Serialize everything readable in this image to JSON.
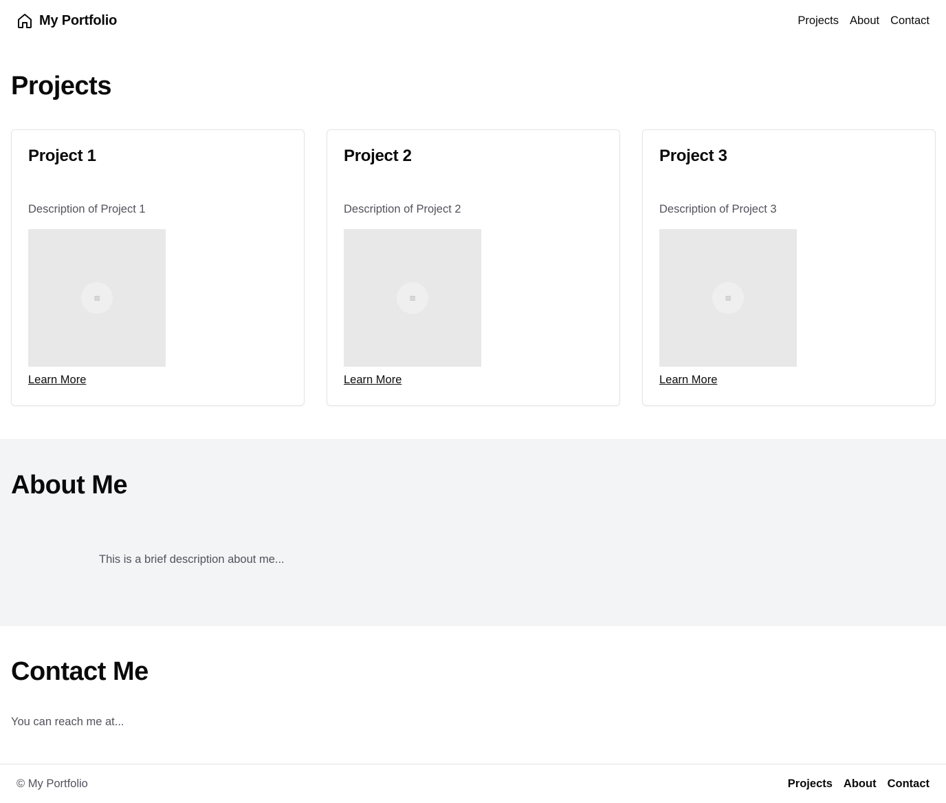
{
  "header": {
    "brand_icon": "home-icon",
    "brand_name": "My Portfolio",
    "nav": [
      "Projects",
      "About",
      "Contact"
    ]
  },
  "projects": {
    "title": "Projects",
    "items": [
      {
        "title": "Project 1",
        "description": "Description of Project 1",
        "image_icon": "image-placeholder-icon",
        "link": "Learn More"
      },
      {
        "title": "Project 2",
        "description": "Description of Project 2",
        "image_icon": "image-placeholder-icon",
        "link": "Learn More"
      },
      {
        "title": "Project 3",
        "description": "Description of Project 3",
        "image_icon": "image-placeholder-icon",
        "link": "Learn More"
      }
    ]
  },
  "about": {
    "title": "About Me",
    "text": "This is a brief description about me..."
  },
  "contact": {
    "title": "Contact Me",
    "text": "You can reach me at..."
  },
  "footer": {
    "copyright": "© My Portfolio",
    "nav": [
      "Projects",
      "About",
      "Contact"
    ]
  },
  "colors": {
    "text": "#0a0a0a",
    "muted_text": "#52525b",
    "about_bg": "#f3f4f6",
    "border": "#e4e4e7",
    "image_placeholder": "#e8e8e8"
  }
}
